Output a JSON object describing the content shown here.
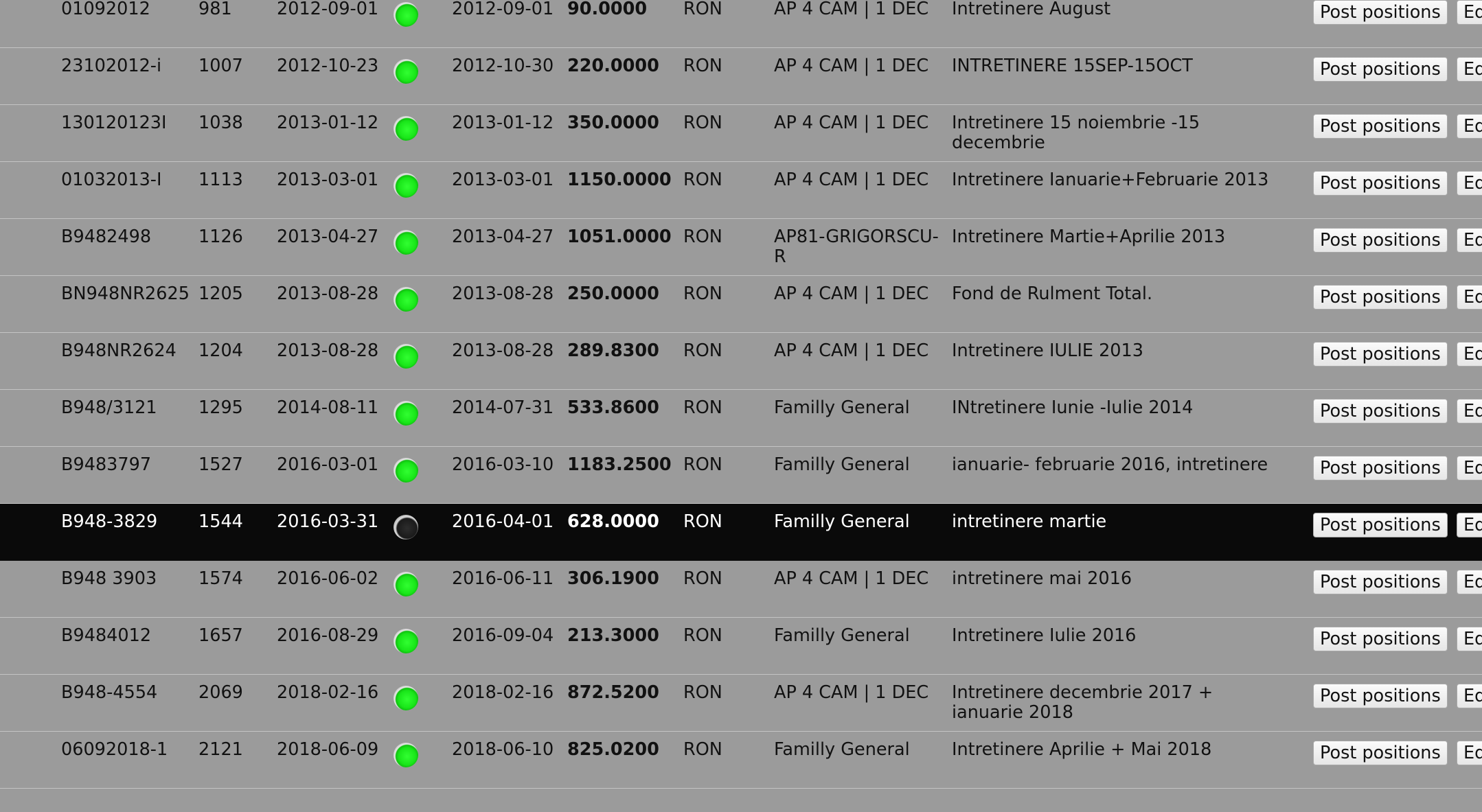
{
  "colors": {
    "page_background": "#9b9b9b",
    "selected_row_background": "#0a0a0a",
    "status_green": "#22ee22"
  },
  "rows": [
    {
      "number": "01092012",
      "id": "981",
      "date": "2012-09-01",
      "status": "green-dot",
      "date2": "2012-09-01",
      "amount": "90.0000",
      "currency": "RON",
      "account": "AP 4 CAM | 1 DEC",
      "description": "Intretinere August",
      "post_label": "Post positions",
      "edit_label": "Ed",
      "selected": false
    },
    {
      "number": "23102012-i",
      "id": "1007",
      "date": "2012-10-23",
      "status": "green-dot",
      "date2": "2012-10-30",
      "amount": "220.0000",
      "currency": "RON",
      "account": "AP 4 CAM | 1 DEC",
      "description": "INTRETINERE 15SEP-15OCT",
      "post_label": "Post positions",
      "edit_label": "Ed",
      "selected": false
    },
    {
      "number": "130120123I",
      "id": "1038",
      "date": "2013-01-12",
      "status": "green-dot",
      "date2": "2013-01-12",
      "amount": "350.0000",
      "currency": "RON",
      "account": "AP 4 CAM | 1 DEC",
      "description": "Intretinere 15 noiembrie -15 decembrie",
      "post_label": "Post positions",
      "edit_label": "Ed",
      "selected": false
    },
    {
      "number": "01032013-I",
      "id": "1113",
      "date": "2013-03-01",
      "status": "green-dot",
      "date2": "2013-03-01",
      "amount": "1150.0000",
      "currency": "RON",
      "account": "AP 4 CAM | 1 DEC",
      "description": "Intretinere Ianuarie+Februarie 2013",
      "post_label": "Post positions",
      "edit_label": "Ed",
      "selected": false
    },
    {
      "number": "B9482498",
      "id": "1126",
      "date": "2013-04-27",
      "status": "green-dot",
      "date2": "2013-04-27",
      "amount": "1051.0000",
      "currency": "RON",
      "account": "AP81-GRIGORSCU-R",
      "description": "Intretinere Martie+Aprilie 2013",
      "post_label": "Post positions",
      "edit_label": "Ed",
      "selected": false
    },
    {
      "number": "BN948NR2625",
      "id": "1205",
      "date": "2013-08-28",
      "status": "green-dot",
      "date2": "2013-08-28",
      "amount": "250.0000",
      "currency": "RON",
      "account": "AP 4 CAM | 1 DEC",
      "description": "Fond de Rulment Total.",
      "post_label": "Post positions",
      "edit_label": "Ed",
      "selected": false
    },
    {
      "number": "B948NR2624",
      "id": "1204",
      "date": "2013-08-28",
      "status": "green-dot",
      "date2": "2013-08-28",
      "amount": "289.8300",
      "currency": "RON",
      "account": "AP 4 CAM | 1 DEC",
      "description": "Intretinere IULIE 2013",
      "post_label": "Post positions",
      "edit_label": "Ed",
      "selected": false
    },
    {
      "number": "B948/3121",
      "id": "1295",
      "date": "2014-08-11",
      "status": "green-dot",
      "date2": "2014-07-31",
      "amount": "533.8600",
      "currency": "RON",
      "account": "Familly General",
      "description": "INtretinere Iunie -Iulie 2014",
      "post_label": "Post positions",
      "edit_label": "Ed",
      "selected": false
    },
    {
      "number": "B9483797",
      "id": "1527",
      "date": "2016-03-01",
      "status": "green-dot",
      "date2": "2016-03-10",
      "amount": "1183.2500",
      "currency": "RON",
      "account": "Familly General",
      "description": "ianuarie- februarie 2016, intretinere",
      "post_label": "Post positions",
      "edit_label": "Ed",
      "selected": false
    },
    {
      "number": "B948-3829",
      "id": "1544",
      "date": "2016-03-31",
      "status": "dark-dot",
      "date2": "2016-04-01",
      "amount": "628.0000",
      "currency": "RON",
      "account": "Familly General",
      "description": "intretinere martie",
      "post_label": "Post positions",
      "edit_label": "Ed",
      "selected": true
    },
    {
      "number": "B948 3903",
      "id": "1574",
      "date": "2016-06-02",
      "status": "green-dot",
      "date2": "2016-06-11",
      "amount": "306.1900",
      "currency": "RON",
      "account": "AP 4 CAM | 1 DEC",
      "description": "intretinere mai 2016",
      "post_label": "Post positions",
      "edit_label": "Ed",
      "selected": false
    },
    {
      "number": "B9484012",
      "id": "1657",
      "date": "2016-08-29",
      "status": "green-dot",
      "date2": "2016-09-04",
      "amount": "213.3000",
      "currency": "RON",
      "account": "Familly General",
      "description": "Intretinere Iulie 2016",
      "post_label": "Post positions",
      "edit_label": "Ed",
      "selected": false
    },
    {
      "number": "B948-4554",
      "id": "2069",
      "date": "2018-02-16",
      "status": "green-dot",
      "date2": "2018-02-16",
      "amount": "872.5200",
      "currency": "RON",
      "account": "AP 4 CAM | 1 DEC",
      "description": "Intretinere decembrie 2017 + ianuarie 2018",
      "post_label": "Post positions",
      "edit_label": "Ed",
      "selected": false
    },
    {
      "number": "06092018-1",
      "id": "2121",
      "date": "2018-06-09",
      "status": "green-dot",
      "date2": "2018-06-10",
      "amount": "825.0200",
      "currency": "RON",
      "account": "Familly General",
      "description": "Intretinere Aprilie + Mai 2018",
      "post_label": "Post positions",
      "edit_label": "Ed",
      "selected": false
    }
  ]
}
